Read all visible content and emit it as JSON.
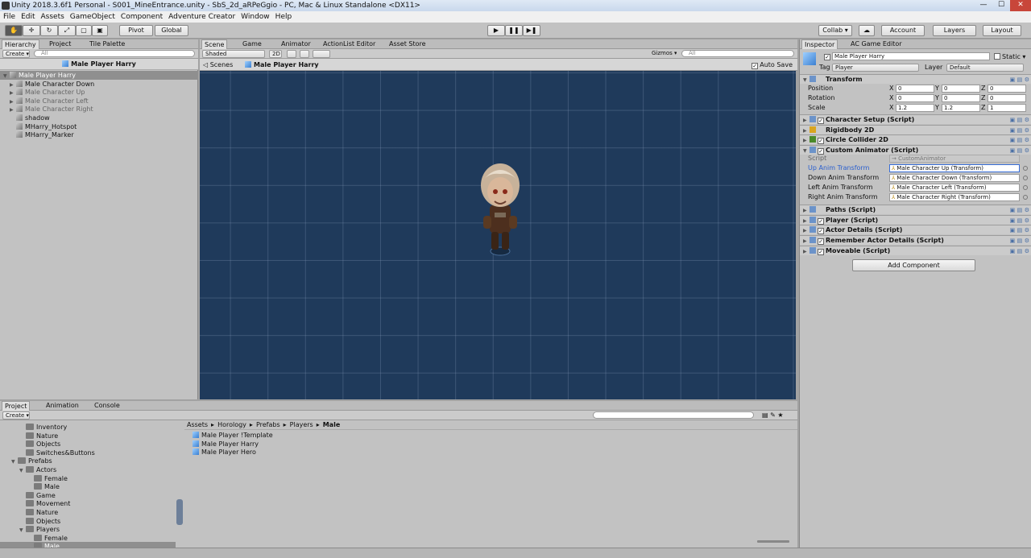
{
  "window": {
    "title": "Unity 2018.3.6f1 Personal - S001_MineEntrance.unity - SbS_2d_aRPeGgio - PC, Mac & Linux Standalone <DX11>",
    "minimize": "—",
    "maximize": "☐",
    "close": "✕"
  },
  "menu": [
    "File",
    "Edit",
    "Assets",
    "GameObject",
    "Component",
    "Adventure Creator",
    "Window",
    "Help"
  ],
  "toolbar": {
    "tools": [
      "✋",
      "✛",
      "↻",
      "⤢",
      "▢",
      "▣"
    ],
    "pivot": "Pivot",
    "global": "Global",
    "play": "▶",
    "pause": "❚❚",
    "step": "▶❚",
    "collab": "Collab ▾",
    "cloud": "☁",
    "account": "Account",
    "layers": "Layers",
    "layout": "Layout"
  },
  "hierarchy": {
    "tabs": [
      "Hierarchy",
      "Project",
      "Tile Palette"
    ],
    "create": "Create ▾",
    "search_placeholder": "All",
    "breadcrumb": "Male Player Harry",
    "items": [
      {
        "label": "Male Player Harry",
        "indent": 0,
        "expand": "▼",
        "selected": true,
        "muted": false,
        "expandable": true
      },
      {
        "label": "Male Character Down",
        "indent": 1,
        "expand": "▶",
        "selected": false,
        "muted": false,
        "expandable": true
      },
      {
        "label": "Male Character Up",
        "indent": 1,
        "expand": "▶",
        "selected": false,
        "muted": true,
        "expandable": true
      },
      {
        "label": "Male Character Left",
        "indent": 1,
        "expand": "▶",
        "selected": false,
        "muted": true,
        "expandable": true
      },
      {
        "label": "Male Character Right",
        "indent": 1,
        "expand": "▶",
        "selected": false,
        "muted": true,
        "expandable": true
      },
      {
        "label": "shadow",
        "indent": 1,
        "expand": "",
        "selected": false,
        "muted": false,
        "expandable": false
      },
      {
        "label": "MHarry_Hotspot",
        "indent": 1,
        "expand": "",
        "selected": false,
        "muted": false,
        "expandable": false
      },
      {
        "label": "MHarry_Marker",
        "indent": 1,
        "expand": "",
        "selected": false,
        "muted": false,
        "expandable": false
      }
    ]
  },
  "scene": {
    "tabs": [
      "Scene",
      "Game",
      "Animator",
      "ActionList Editor",
      "Asset Store"
    ],
    "shading": "Shaded",
    "mode_2d": "2D",
    "gizmos": "Gizmos ▾",
    "search_placeholder": "All",
    "scenes_label": "Scenes",
    "breadcrumb": "Male Player Harry",
    "auto_save": "Auto Save",
    "grid_color": "#2c4a6e",
    "bg_color": "#1f3a5b"
  },
  "project": {
    "tabs": [
      "Project",
      "Animation",
      "Console"
    ],
    "create": "Create ▾",
    "tree": [
      {
        "label": "Inventory",
        "indent": 2,
        "expand": ""
      },
      {
        "label": "Nature",
        "indent": 2,
        "expand": ""
      },
      {
        "label": "Objects",
        "indent": 2,
        "expand": ""
      },
      {
        "label": "Switches&Buttons",
        "indent": 2,
        "expand": ""
      },
      {
        "label": "Prefabs",
        "indent": 1,
        "expand": "▼"
      },
      {
        "label": "Actors",
        "indent": 2,
        "expand": "▼"
      },
      {
        "label": "Female",
        "indent": 3,
        "expand": ""
      },
      {
        "label": "Male",
        "indent": 3,
        "expand": ""
      },
      {
        "label": "Game",
        "indent": 2,
        "expand": ""
      },
      {
        "label": "Movement",
        "indent": 2,
        "expand": ""
      },
      {
        "label": "Nature",
        "indent": 2,
        "expand": ""
      },
      {
        "label": "Objects",
        "indent": 2,
        "expand": ""
      },
      {
        "label": "Players",
        "indent": 2,
        "expand": "▼"
      },
      {
        "label": "Female",
        "indent": 3,
        "expand": ""
      },
      {
        "label": "Male",
        "indent": 3,
        "expand": "",
        "selected": true
      }
    ],
    "path": [
      "Assets",
      "Horology",
      "Prefabs",
      "Players",
      "Male"
    ],
    "path_sep": "▸",
    "assets": [
      "Male Player !Template",
      "Male Player Harry",
      "Male Player Hero"
    ]
  },
  "inspector": {
    "tabs": [
      "Inspector",
      "AC Game Editor"
    ],
    "object_name": "Male Player Harry",
    "static_label": "Static ▾",
    "tag_label": "Tag",
    "tag_value": "Player",
    "layer_label": "Layer",
    "layer_value": "Default",
    "transform": {
      "title": "Transform",
      "rows": [
        {
          "label": "Position",
          "x": "0",
          "y": "0",
          "z": "0"
        },
        {
          "label": "Rotation",
          "x": "0",
          "y": "0",
          "z": "0"
        },
        {
          "label": "Scale",
          "x": "1.2",
          "y": "1.2",
          "z": "1"
        }
      ],
      "axis_labels": [
        "X",
        "Y",
        "Z"
      ]
    },
    "components_top": [
      {
        "title": "Character Setup (Script)",
        "checkbox": true,
        "icon": "script-icon"
      },
      {
        "title": "Rigidbody 2D",
        "checkbox": false,
        "icon": "rigidbody-icon"
      },
      {
        "title": "Circle Collider 2D",
        "checkbox": true,
        "icon": "collider-icon"
      },
      {
        "title": "Custom Animator (Script)",
        "checkbox": true,
        "icon": "script-icon",
        "expanded": true
      }
    ],
    "custom_animator": {
      "script_label": "Script",
      "script_value": "→ CustomAnimator",
      "fields": [
        {
          "label": "Up Anim Transform",
          "value": "Male Character Up (Transform)",
          "highlight": true
        },
        {
          "label": "Down Anim Transform",
          "value": "Male Character Down (Transform)",
          "highlight": false
        },
        {
          "label": "Left Anim Transform",
          "value": "Male Character Left (Transform)",
          "highlight": false
        },
        {
          "label": "Right Anim Transform",
          "value": "Male Character Right (Transform)",
          "highlight": false
        }
      ]
    },
    "components_bottom": [
      {
        "title": "Paths (Script)",
        "checkbox": false
      },
      {
        "title": "Player (Script)",
        "checkbox": true
      },
      {
        "title": "Actor Details (Script)",
        "checkbox": true
      },
      {
        "title": "Remember Actor Details (Script)",
        "checkbox": true
      },
      {
        "title": "Moveable (Script)",
        "checkbox": true
      }
    ],
    "add_component": "Add Component"
  }
}
